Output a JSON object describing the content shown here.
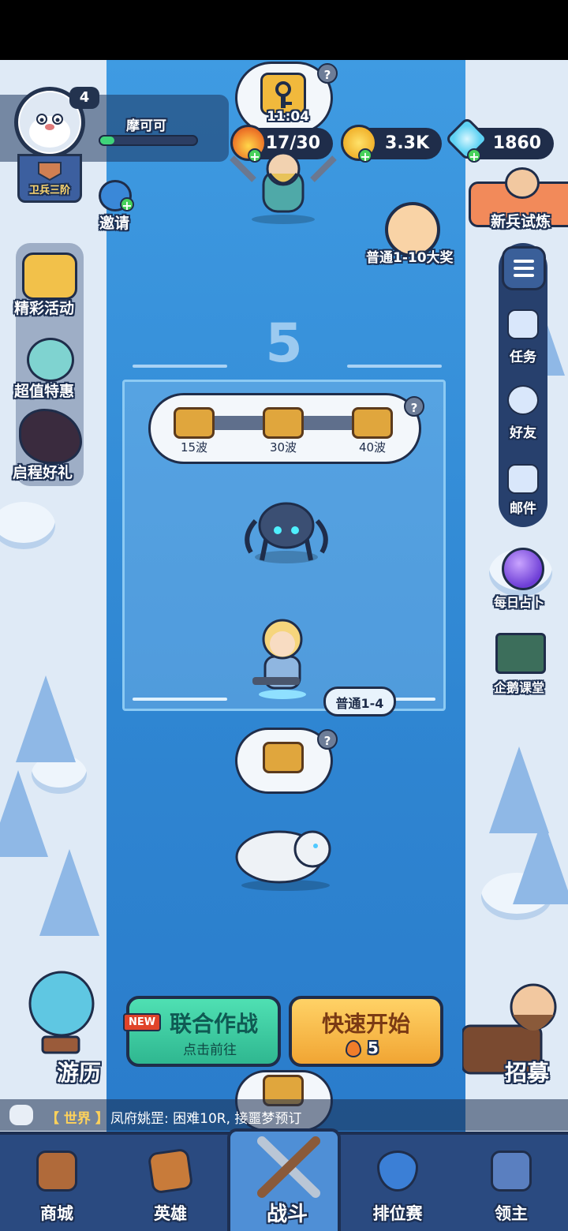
{
  "player": {
    "name": "摩可可",
    "level": "4",
    "rank": "卫兵三阶",
    "xp_fraction": 0.15
  },
  "resources": {
    "energy": "17/30",
    "gold": "3.3K",
    "gems": "1860"
  },
  "timer": "11:04",
  "invite_label": "邀请",
  "trial_label": "新兵试炼",
  "grand_prize_label": "普通1-10大奖",
  "left_menu": [
    {
      "label": "精彩活动"
    },
    {
      "label": "超值特惠"
    },
    {
      "label": "启程好礼"
    }
  ],
  "right_menu": [
    {
      "label": "任务"
    },
    {
      "label": "好友"
    },
    {
      "label": "邮件"
    }
  ],
  "daily_fortune_label": "每日占卜",
  "penguin_class_label": "企鹅课堂",
  "stage_number": "5",
  "chest_rewards": [
    {
      "label": "15波"
    },
    {
      "label": "30波"
    },
    {
      "label": "40波"
    }
  ],
  "current_stage_tag": "普通1-4",
  "help_mark": "?",
  "travel_label": "游历",
  "recruit_label": "招募",
  "coop_button": {
    "badge": "NEW",
    "title": "联合作战",
    "subtitle": "点击前往"
  },
  "quick_button": {
    "title": "快速开始",
    "cost": "5"
  },
  "chat": {
    "channel": "【 世界 】",
    "message": "凤府姚罡: 困难10R, 接噩梦预订"
  },
  "nav": [
    {
      "label": "商城"
    },
    {
      "label": "英雄"
    },
    {
      "label": "战斗"
    },
    {
      "label": "排位赛"
    },
    {
      "label": "领主"
    }
  ],
  "colors": {
    "river": "#2f86d2",
    "panel_dark": "#1f2d4a",
    "coop_green": "#3ccaa0",
    "quick_gold": "#f6b844",
    "nav_bg": "#2a4a80"
  }
}
